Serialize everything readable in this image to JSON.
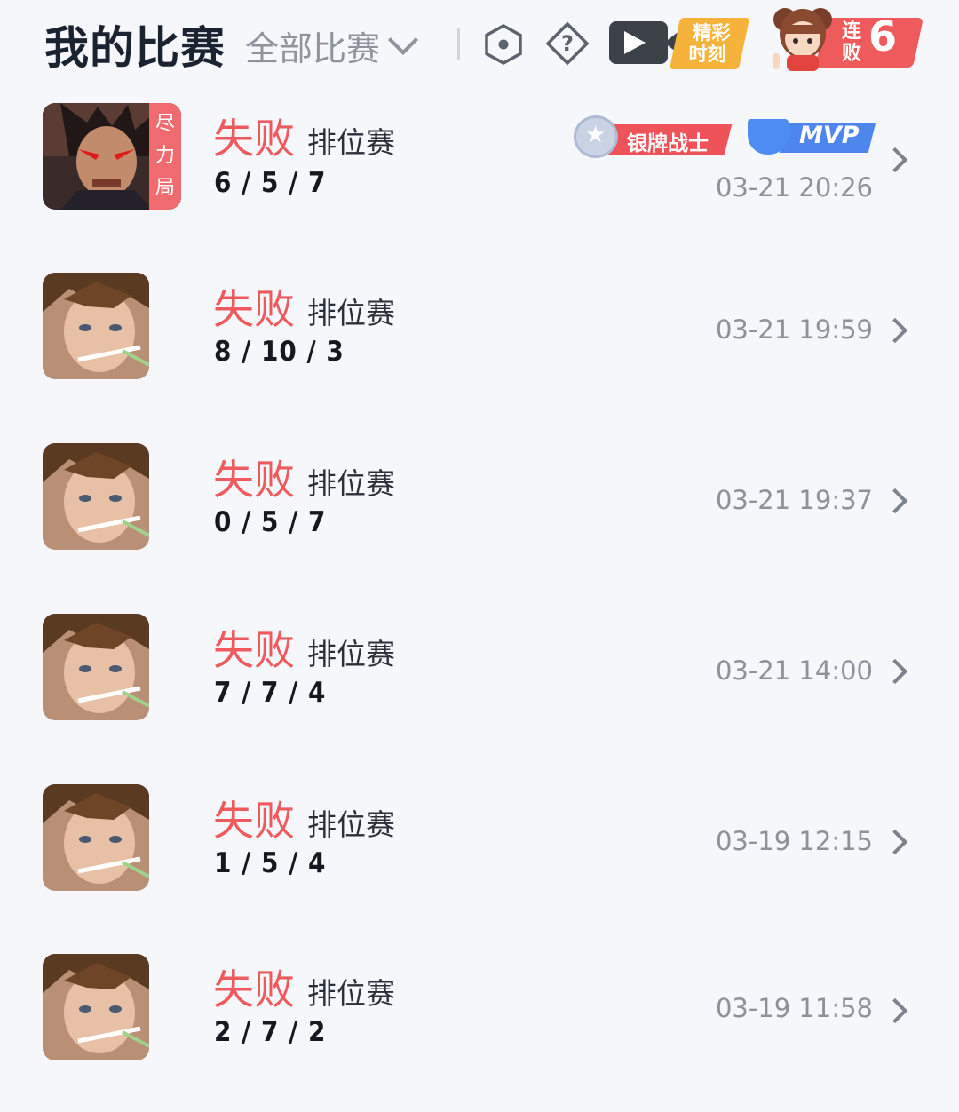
{
  "header": {
    "title": "我的比赛",
    "filter_label": "全部比赛",
    "highlight_label_1": "精彩",
    "highlight_label_2": "时刻",
    "streak_label_1": "连",
    "streak_label_2": "败",
    "streak_count": "6"
  },
  "colors": {
    "loss": "#ee5a5d",
    "accent_orange": "#f5b33b",
    "mvp_blue": "#4f86ee"
  },
  "matches": [
    {
      "result": "失败",
      "mode": "排位赛",
      "kda": "6 / 5 / 7",
      "time": "03-21 20:26",
      "avatar_badge": [
        "尽",
        "力",
        "局"
      ],
      "medal_label": "银牌战士",
      "mvp_label": "MVP"
    },
    {
      "result": "失败",
      "mode": "排位赛",
      "kda": "8 / 10 / 3",
      "time": "03-21 19:59"
    },
    {
      "result": "失败",
      "mode": "排位赛",
      "kda": "0 / 5 / 7",
      "time": "03-21 19:37"
    },
    {
      "result": "失败",
      "mode": "排位赛",
      "kda": "7 / 7 / 4",
      "time": "03-21 14:00"
    },
    {
      "result": "失败",
      "mode": "排位赛",
      "kda": "1 / 5 / 4",
      "time": "03-19 12:15"
    },
    {
      "result": "失败",
      "mode": "排位赛",
      "kda": "2 / 7 / 2",
      "time": "03-19 11:58"
    }
  ]
}
